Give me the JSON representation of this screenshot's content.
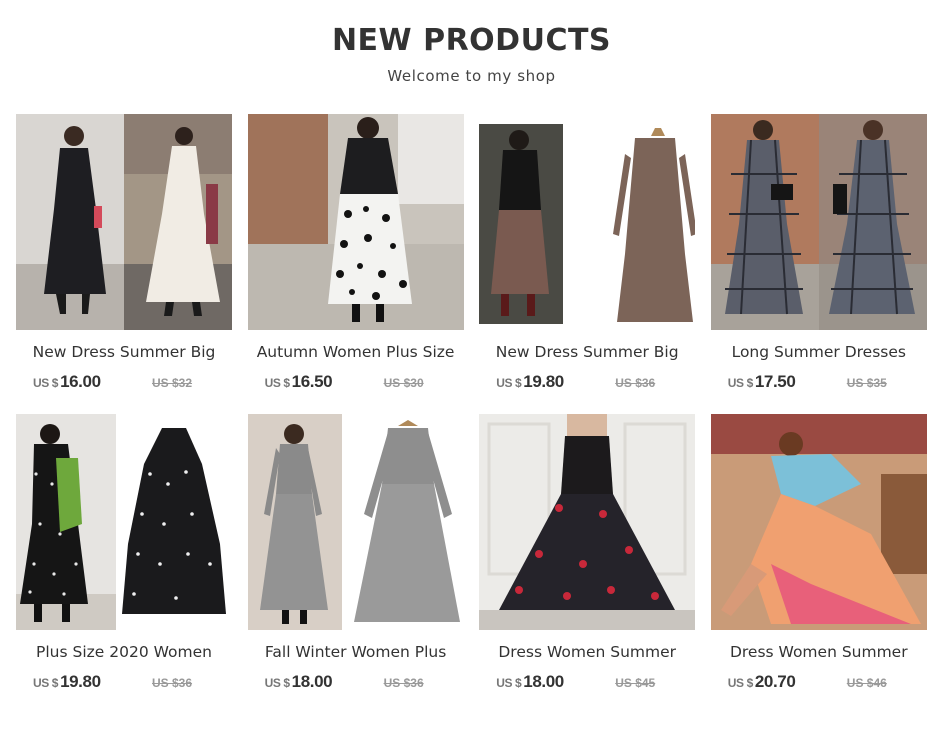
{
  "header": {
    "title": "NEW PRODUCTS",
    "subtitle": "Welcome to my shop"
  },
  "products": [
    {
      "name": "New Dress Summer Big",
      "currency": "US $",
      "price": "16.00",
      "old_price": "US $32",
      "image": "dress-photo"
    },
    {
      "name": "Autumn Women Plus Size",
      "currency": "US $",
      "price": "16.50",
      "old_price": "US $30",
      "image": "dress-photo"
    },
    {
      "name": "New Dress Summer Big",
      "currency": "US $",
      "price": "19.80",
      "old_price": "US $36",
      "image": "dress-photo"
    },
    {
      "name": "Long Summer Dresses",
      "currency": "US $",
      "price": "17.50",
      "old_price": "US $35",
      "image": "dress-photo"
    },
    {
      "name": "Plus Size 2020 Women",
      "currency": "US $",
      "price": "19.80",
      "old_price": "US $36",
      "image": "dress-photo"
    },
    {
      "name": "Fall Winter Women Plus",
      "currency": "US $",
      "price": "18.00",
      "old_price": "US $36",
      "image": "dress-photo"
    },
    {
      "name": "Dress Women Summer",
      "currency": "US $",
      "price": "18.00",
      "old_price": "US $45",
      "image": "dress-photo"
    },
    {
      "name": "Dress Women Summer",
      "currency": "US $",
      "price": "20.70",
      "old_price": "US $46",
      "image": "dress-photo"
    }
  ],
  "colors": {
    "title": "#333333",
    "price": "#333333",
    "old_price": "#999999"
  }
}
